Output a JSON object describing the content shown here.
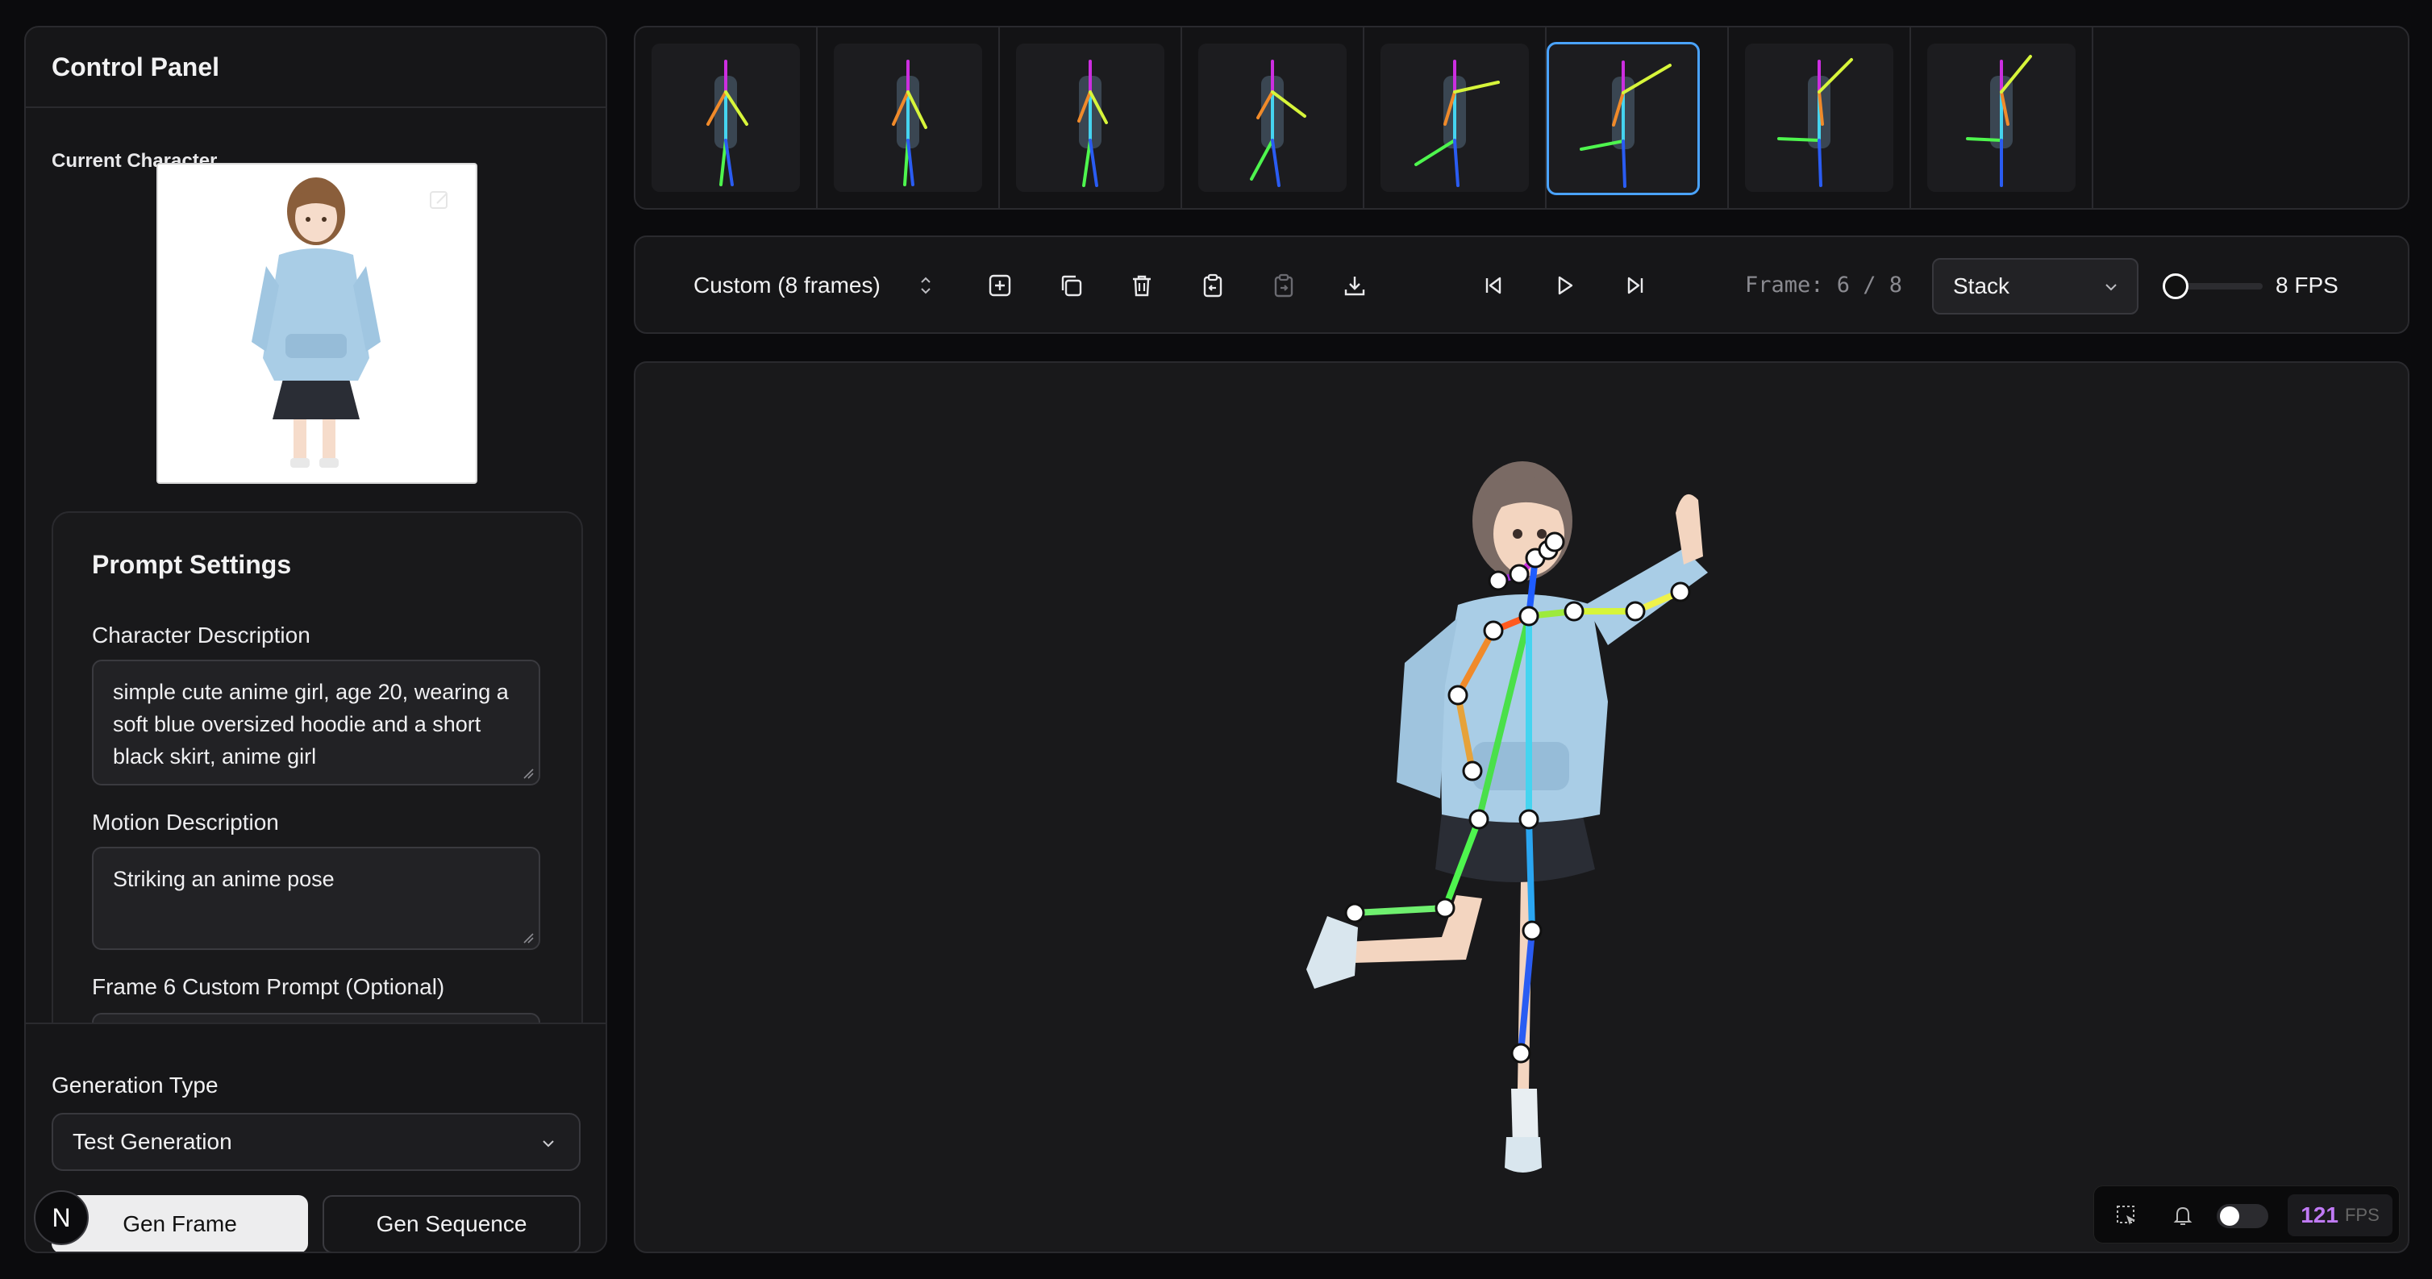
{
  "control_panel": {
    "title": "Control Panel",
    "current_character_label": "Current Character",
    "prompt_settings": {
      "title": "Prompt Settings",
      "character_description_label": "Character Description",
      "character_description_value": "simple cute anime girl, age 20, wearing a soft blue oversized hoodie and a short black skirt, anime girl",
      "motion_description_label": "Motion Description",
      "motion_description_value": "Striking an anime pose",
      "frame_prompt_label": "Frame 6 Custom Prompt (Optional)"
    },
    "generation_type_label": "Generation Type",
    "generation_type_value": "Test Generation",
    "gen_frame_label": "Gen Frame",
    "gen_sequence_label": "Gen Sequence",
    "badge_letter": "N"
  },
  "timeline": {
    "frame_count": 8,
    "selected_index": 5
  },
  "toolbar": {
    "preset_label": "Custom (8 frames)",
    "frame_counter": "Frame: 6 / 8",
    "view_mode": "Stack",
    "fps_label": "8 FPS",
    "fps_slider_fraction": 0.1
  },
  "devtools": {
    "fps_value": "121",
    "fps_unit": "FPS"
  },
  "colors": {
    "accent_selected": "#4aa3ff",
    "fps_purple": "#c07af5",
    "hoodie": "#a9cde6",
    "skirt": "#2a2d35"
  }
}
